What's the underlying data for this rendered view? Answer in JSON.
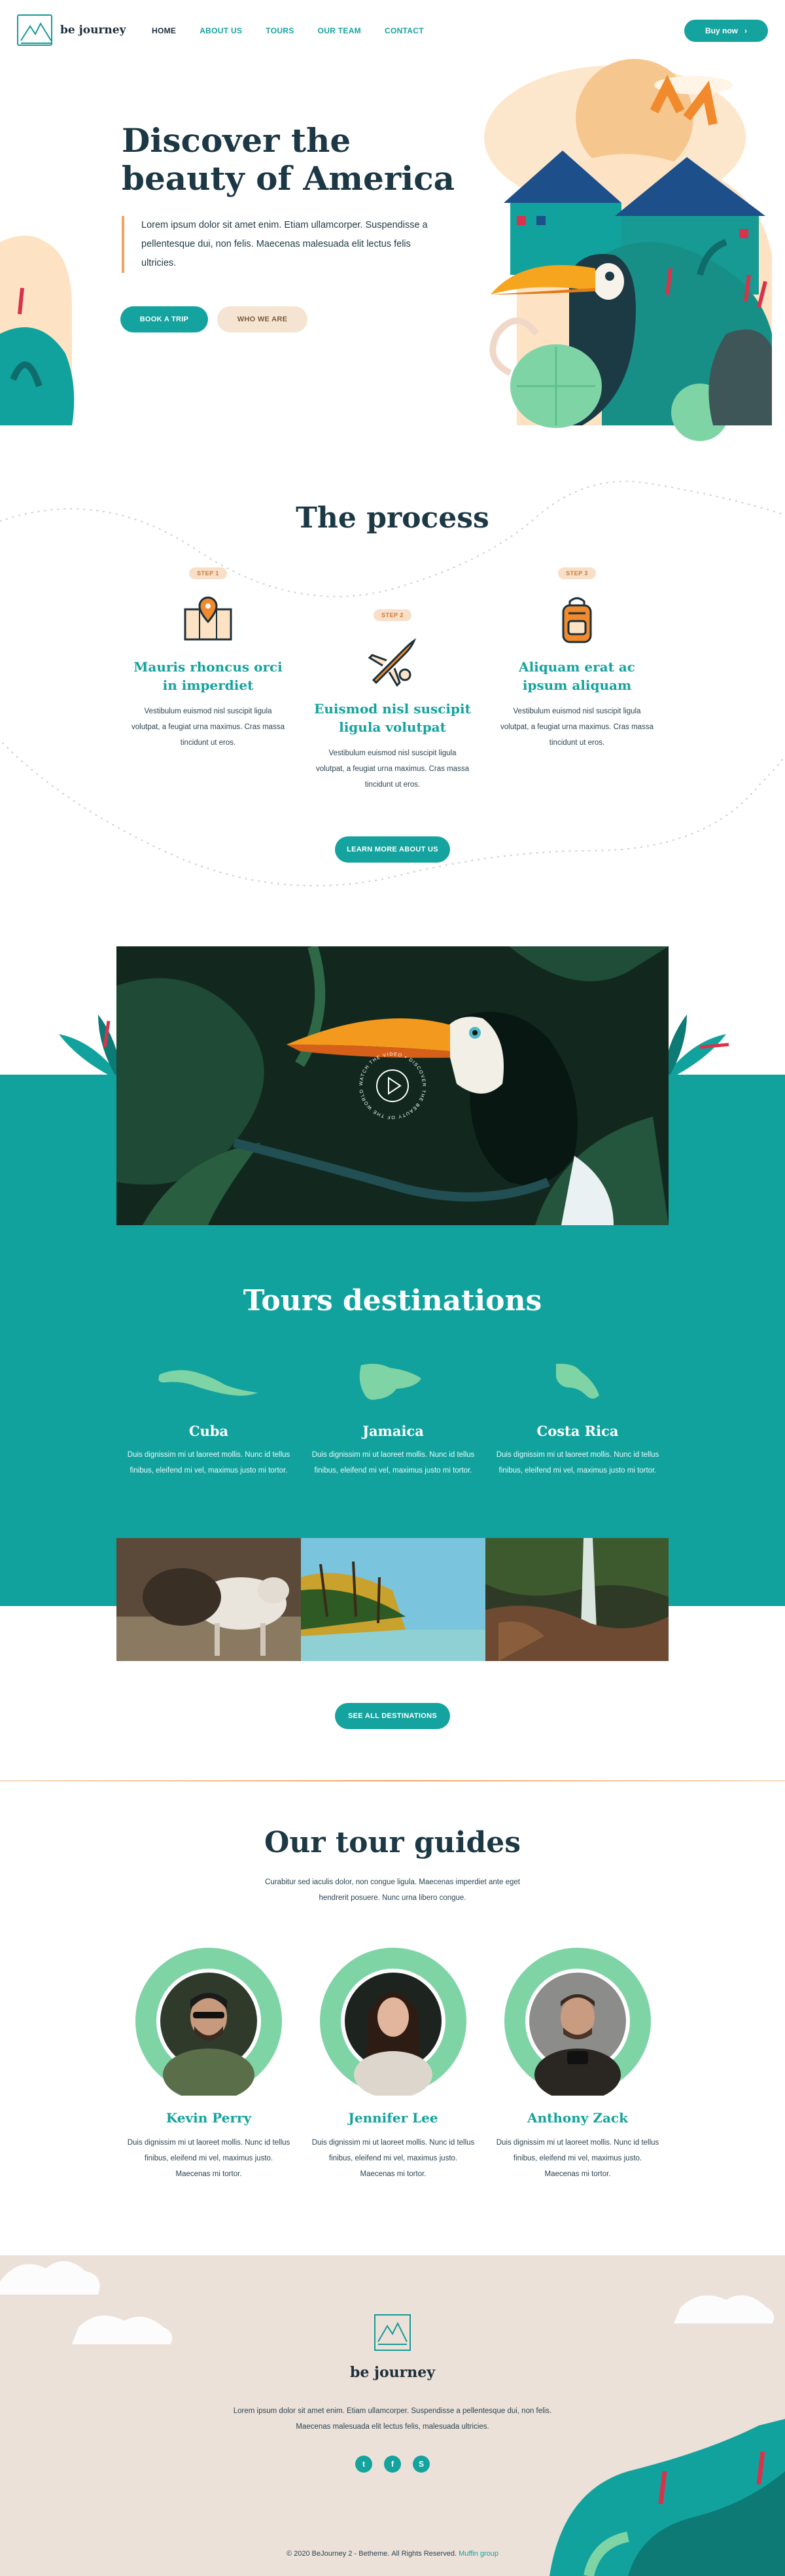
{
  "brand": {
    "name": "be journey"
  },
  "nav": {
    "items": [
      {
        "label": "HOME"
      },
      {
        "label": "ABOUT US"
      },
      {
        "label": "TOURS"
      },
      {
        "label": "OUR TEAM"
      },
      {
        "label": "CONTACT"
      }
    ],
    "buy_label": "Buy now"
  },
  "hero": {
    "title_line1": "Discover the",
    "title_line2": "beauty of America",
    "description": "Lorem ipsum dolor sit amet enim. Etiam ullamcorper. Suspendisse a pellentesque dui, non felis. Maecenas malesuada elit lectus felis ultricies.",
    "book_label": "BOOK A TRIP",
    "who_label": "WHO WE ARE"
  },
  "process": {
    "title": "The process",
    "steps": [
      {
        "badge": "STEP 1",
        "title": "Mauris rhoncus orci in imperdiet",
        "text": "Vestibulum euismod nisl suscipit ligula volutpat, a feugiat urna maximus. Cras massa tincidunt ut eros."
      },
      {
        "badge": "STEP 2",
        "title": "Euismod nisl suscipit ligula volutpat",
        "text": "Vestibulum euismod nisl suscipit ligula volutpat, a feugiat urna maximus. Cras massa tincidunt ut eros."
      },
      {
        "badge": "STEP 3",
        "title": "Aliquam erat ac ipsum aliquam",
        "text": "Vestibulum euismod nisl suscipit ligula volutpat, a feugiat urna maximus. Cras massa tincidunt ut eros."
      }
    ],
    "learn_label": "LEARN MORE ABOUT US"
  },
  "video": {
    "ring_text": "WATCH THE VIDEO • DISCOVER THE BEAUTY OF THE WORLD •"
  },
  "destinations": {
    "title": "Tours destinations",
    "items": [
      {
        "name": "Cuba",
        "text": "Duis dignissim mi ut laoreet mollis. Nunc id tellus finibus, eleifend mi vel, maximus justo mi tortor."
      },
      {
        "name": "Jamaica",
        "text": "Duis dignissim mi ut laoreet mollis. Nunc id tellus finibus, eleifend mi vel, maximus justo mi tortor."
      },
      {
        "name": "Costa Rica",
        "text": "Duis dignissim mi ut laoreet mollis. Nunc id tellus finibus, eleifend mi vel, maximus justo mi tortor."
      }
    ],
    "see_all_label": "SEE ALL DESTINATIONS"
  },
  "guides": {
    "title": "Our tour guides",
    "subtitle": "Curabitur sed iaculis dolor, non congue ligula. Maecenas imperdiet ante eget hendrerit posuere. Nunc urna libero congue.",
    "people": [
      {
        "name": "Kevin Perry",
        "text": "Duis dignissim mi ut laoreet mollis. Nunc id tellus finibus, eleifend mi vel, maximus justo. Maecenas mi tortor."
      },
      {
        "name": "Jennifer Lee",
        "text": "Duis dignissim mi ut laoreet mollis. Nunc id tellus finibus, eleifend mi vel, maximus justo. Maecenas mi tortor."
      },
      {
        "name": "Anthony Zack",
        "text": "Duis dignissim mi ut laoreet mollis. Nunc id tellus finibus, eleifend mi vel, maximus justo. Maecenas mi tortor."
      }
    ]
  },
  "footer": {
    "brand": "be journey",
    "description": "Lorem ipsum dolor sit amet enim. Etiam ullamcorper. Suspendisse a pellentesque dui, non felis. Maecenas malesuada elit lectus felis, malesuada ultricies.",
    "social": [
      {
        "icon": "twitter-icon",
        "glyph": "t"
      },
      {
        "icon": "facebook-icon",
        "glyph": "f"
      },
      {
        "icon": "skype-icon",
        "glyph": "S"
      }
    ],
    "copyright": "© 2020 BeJourney 2 - Bethemе. All Rights Reserved.",
    "credit": "Muffin group"
  },
  "colors": {
    "accent": "#14a39e",
    "dark": "#1c3845",
    "peach": "#f9dfc8",
    "sand": "#ece1d9"
  }
}
